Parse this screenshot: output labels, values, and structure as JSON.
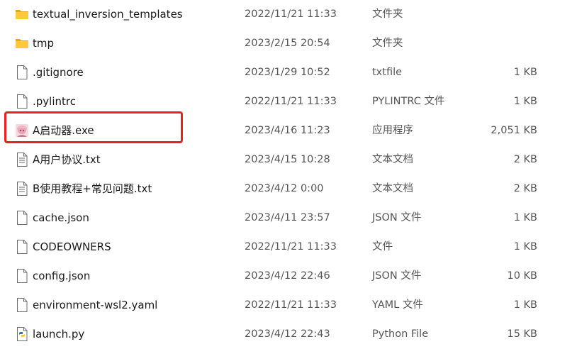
{
  "files": [
    {
      "name": "textual_inversion_templates",
      "date": "2022/11/21 11:33",
      "type": "文件夹",
      "size": "",
      "icon": "folder-icon"
    },
    {
      "name": "tmp",
      "date": "2023/2/15 20:54",
      "type": "文件夹",
      "size": "",
      "icon": "folder-icon"
    },
    {
      "name": ".gitignore",
      "date": "2023/1/29 10:52",
      "type": "txtfile",
      "size": "1 KB",
      "icon": "document-icon"
    },
    {
      "name": ".pylintrc",
      "date": "2022/11/21 11:33",
      "type": "PYLINTRC 文件",
      "size": "1 KB",
      "icon": "document-icon"
    },
    {
      "name": "A启动器.exe",
      "date": "2023/4/16 11:23",
      "type": "应用程序",
      "size": "2,051 KB",
      "icon": "app-icon"
    },
    {
      "name": "A用户协议.txt",
      "date": "2023/4/15 10:28",
      "type": "文本文档",
      "size": "2 KB",
      "icon": "text-document-icon"
    },
    {
      "name": "B使用教程+常见问题.txt",
      "date": "2023/4/12 0:00",
      "type": "文本文档",
      "size": "2 KB",
      "icon": "text-document-icon"
    },
    {
      "name": "cache.json",
      "date": "2023/4/11 23:57",
      "type": "JSON 文件",
      "size": "1 KB",
      "icon": "document-icon"
    },
    {
      "name": "CODEOWNERS",
      "date": "2022/11/21 11:33",
      "type": "文件",
      "size": "1 KB",
      "icon": "document-icon"
    },
    {
      "name": "config.json",
      "date": "2023/4/12 22:46",
      "type": "JSON 文件",
      "size": "10 KB",
      "icon": "document-icon"
    },
    {
      "name": "environment-wsl2.yaml",
      "date": "2022/11/21 11:33",
      "type": "YAML 文件",
      "size": "1 KB",
      "icon": "document-icon"
    },
    {
      "name": "launch.py",
      "date": "2023/4/12 22:43",
      "type": "Python File",
      "size": "15 KB",
      "icon": "python-file-icon"
    }
  ],
  "highlight": {
    "row": 4,
    "color": "#e8231b"
  }
}
